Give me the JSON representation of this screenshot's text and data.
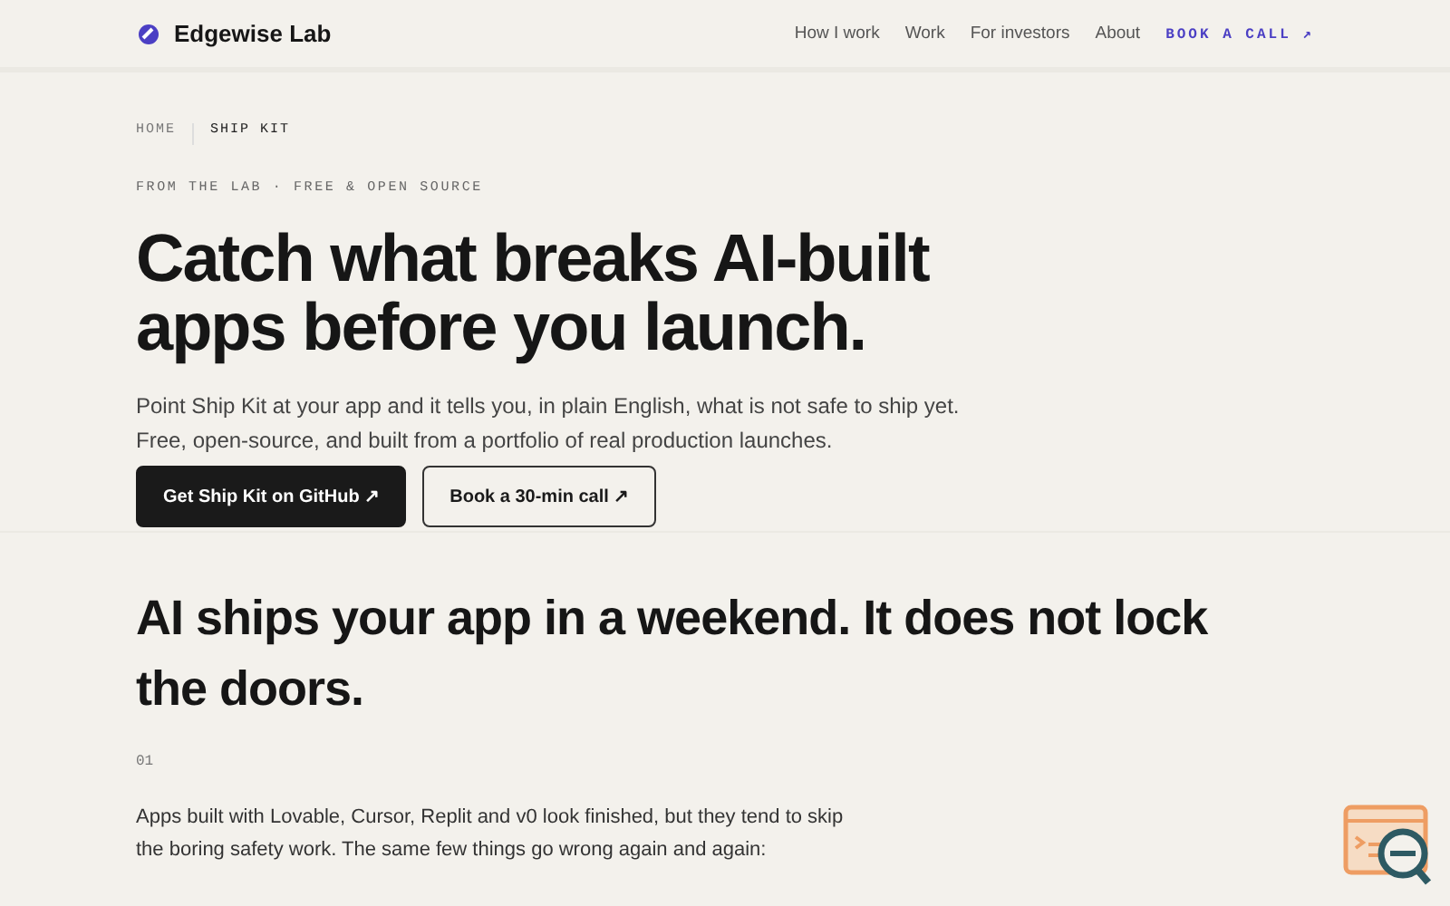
{
  "header": {
    "brand": "Edgewise Lab",
    "nav": [
      {
        "label": "How I work",
        "kind": "link"
      },
      {
        "label": "Work",
        "kind": "link"
      },
      {
        "label": "For investors",
        "kind": "link"
      },
      {
        "label": "About",
        "kind": "link"
      },
      {
        "label": "BOOK A CALL",
        "kind": "cta",
        "arrow": "↗"
      }
    ]
  },
  "breadcrumb": [
    {
      "label": "HOME",
      "current": false
    },
    {
      "label": "SHIP KIT",
      "current": true
    }
  ],
  "hero": {
    "eyebrow": "FROM THE LAB · FREE & OPEN SOURCE",
    "title": "Catch what breaks AI-built apps before you launch.",
    "intro": "Point Ship Kit at your app and it tells you, in plain English, what is not safe to ship yet. Free, open-source, and built from a portfolio of real production launches.",
    "buttons": [
      {
        "label": "Get Ship Kit on GitHub",
        "arrow": "↗",
        "kind": "primary"
      },
      {
        "label": "Book a 30-min call",
        "arrow": "↗",
        "kind": "secondary"
      }
    ]
  },
  "section": {
    "title": "AI ships your app in a weekend. It does not lock the doors.",
    "number": "01",
    "body": "Apps built with Lovable, Cursor, Replit and v0 look finished, but they tend to skip the boring safety work. The same few things go wrong again and again:"
  }
}
